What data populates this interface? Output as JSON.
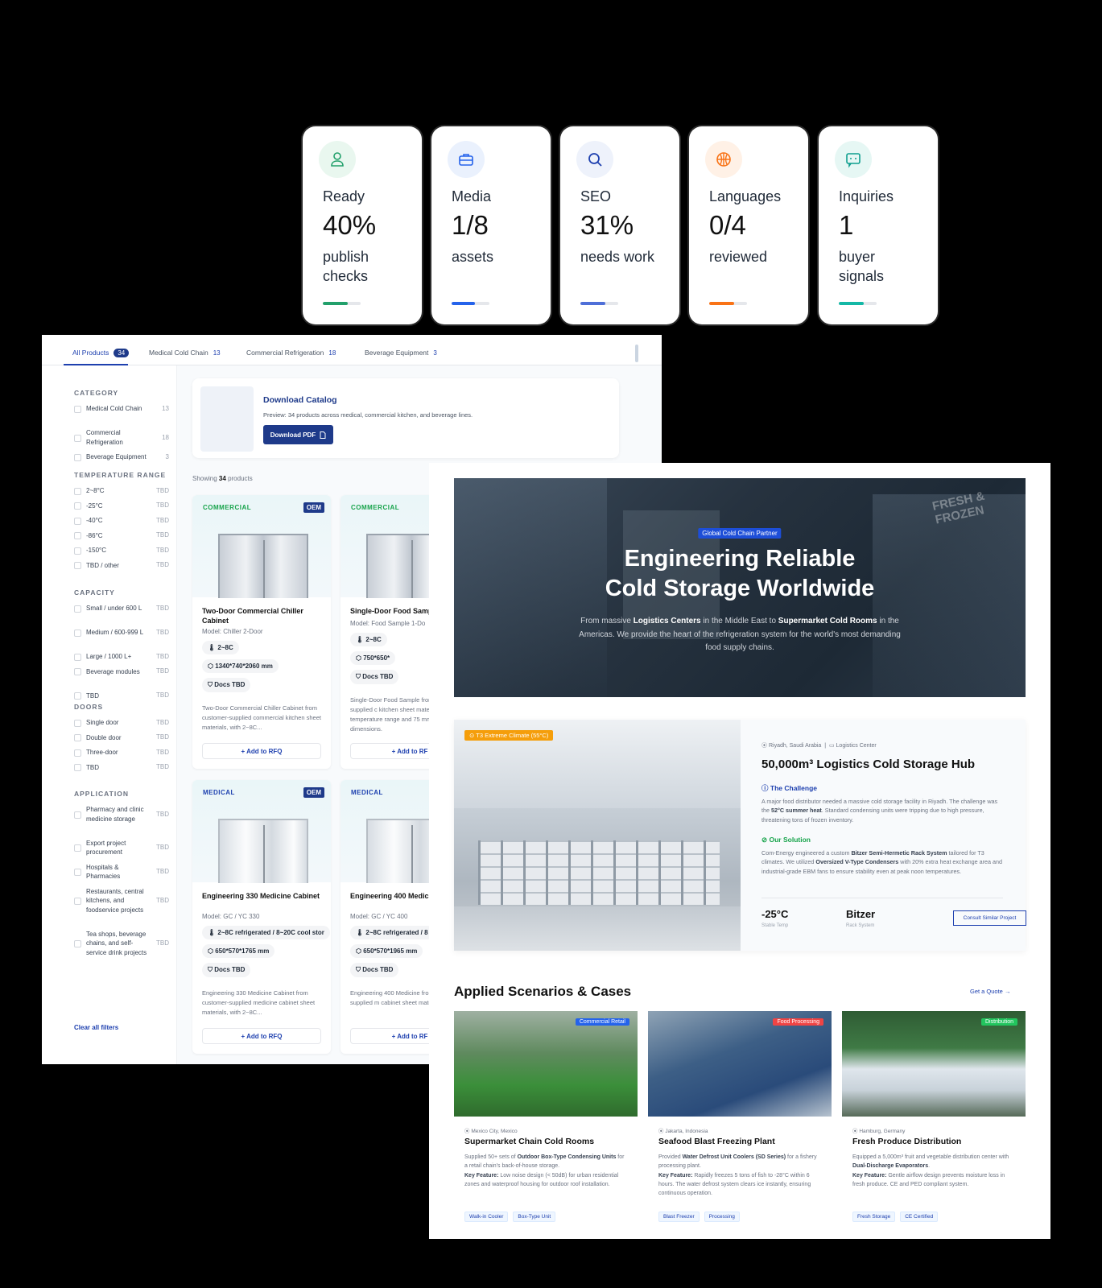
{
  "stats": [
    {
      "label": "Ready",
      "value": "40%",
      "sub": "publish checks",
      "icon": "user-icon",
      "icon_color": "#22a06b",
      "icon_bg": "#e9f7ef",
      "bar_color": "#22a06b",
      "progress": 0.65
    },
    {
      "label": "Media",
      "value": "1/8",
      "sub": "assets",
      "icon": "briefcase-icon",
      "icon_color": "#2563eb",
      "icon_bg": "#eaf1fd",
      "bar_color": "#2563eb",
      "progress": 0.62
    },
    {
      "label": "SEO",
      "value": "31%",
      "sub": "needs work",
      "icon": "search-icon",
      "icon_color": "#1e40af",
      "icon_bg": "#eef2fb",
      "bar_color": "#4f6fd8",
      "progress": 0.66
    },
    {
      "label": "Languages",
      "value": "0/4",
      "sub": "reviewed",
      "icon": "globe-icon",
      "icon_color": "#f97316",
      "icon_bg": "#fff1e6",
      "bar_color": "#f97316",
      "progress": 0.66
    },
    {
      "label": "Inquiries",
      "value": "1",
      "sub": "buyer signals",
      "icon": "chat-icon",
      "icon_color": "#0f9f8f",
      "icon_bg": "#e6f7f4",
      "bar_color": "#14b8a6",
      "progress": 0.66
    }
  ],
  "catalog": {
    "tabs": [
      {
        "label": "All Products",
        "count": "34"
      },
      {
        "label": "Medical Cold Chain",
        "count": "13"
      },
      {
        "label": "Commercial Refrigeration",
        "count": "18"
      },
      {
        "label": "Beverage Equipment",
        "count": "3"
      }
    ],
    "filters": {
      "category": {
        "title": "CATEGORY",
        "items": [
          {
            "label": "Medical Cold Chain",
            "count": "13"
          },
          {
            "label": "Commercial Refrigeration",
            "count": "18"
          },
          {
            "label": "Beverage Equipment",
            "count": "3"
          }
        ]
      },
      "temperature": {
        "title": "TEMPERATURE RANGE",
        "items": [
          {
            "label": "2~8°C",
            "count": "TBD"
          },
          {
            "label": "-25°C",
            "count": "TBD"
          },
          {
            "label": "-40°C",
            "count": "TBD"
          },
          {
            "label": "-86°C",
            "count": "TBD"
          },
          {
            "label": "-150°C",
            "count": "TBD"
          },
          {
            "label": "TBD / other",
            "count": "TBD"
          }
        ]
      },
      "capacity": {
        "title": "CAPACITY",
        "items": [
          {
            "label": "Small / under 600 L",
            "count": "TBD"
          },
          {
            "label": "Medium / 600-999 L",
            "count": "TBD"
          },
          {
            "label": "Large / 1000 L+",
            "count": "TBD"
          },
          {
            "label": "Beverage modules",
            "count": "TBD"
          },
          {
            "label": "TBD",
            "count": "TBD"
          }
        ]
      },
      "doors": {
        "title": "DOORS",
        "items": [
          {
            "label": "Single door",
            "count": "TBD"
          },
          {
            "label": "Double door",
            "count": "TBD"
          },
          {
            "label": "Three-door",
            "count": "TBD"
          },
          {
            "label": "TBD",
            "count": "TBD"
          }
        ]
      },
      "application": {
        "title": "APPLICATION",
        "items": [
          {
            "label": "Pharmacy and clinic medicine storage",
            "count": "TBD"
          },
          {
            "label": "Export project procurement",
            "count": "TBD"
          },
          {
            "label": "Hospitals & Pharmacies",
            "count": "TBD"
          },
          {
            "label": "Restaurants, central kitchens, and foodservice projects",
            "count": "TBD"
          },
          {
            "label": "Tea shops, beverage chains, and self-service drink projects",
            "count": "TBD"
          }
        ]
      },
      "clear_label": "Clear all filters"
    },
    "download": {
      "title": "Download Catalog",
      "preview": "Preview: 34 products across medical, commercial kitchen, and beverage lines.",
      "button": "Download PDF"
    },
    "showing_prefix": "Showing",
    "showing_count": "34",
    "showing_suffix": "products",
    "products": [
      {
        "tag": "COMMERCIAL",
        "tag_color": "#16a34a",
        "oem": "OEM",
        "name": "Two-Door Commercial Chiller Cabinet",
        "model": "Model: Chiller 2-Door",
        "temp": "2~8C",
        "dims": "1340*740*2060 mm",
        "docs": "Docs TBD",
        "desc": "Two-Door Commercial Chiller Cabinet from customer-supplied commercial kitchen sheet materials, with 2~8C...",
        "rfq": "+ Add to RFQ"
      },
      {
        "tag": "COMMERCIAL",
        "tag_color": "#16a34a",
        "oem": "",
        "name": "Single-Door Food Samp",
        "model": "Model: Food Sample 1-Do",
        "temp": "2~8C",
        "dims": "750*650*",
        "docs": "Docs TBD",
        "desc": "Single-Door Food Sample from customer-supplied c kitchen sheet materials, w temperature range and 75 mm cabinet dimensions.",
        "rfq": "+ Add to RF"
      },
      {
        "tag": "MEDICAL",
        "tag_color": "#1e40af",
        "oem": "OEM",
        "name": "Engineering 330 Medicine Cabinet",
        "model": "Model: GC / YC 330",
        "temp": "2~8C refrigerated / 8~20C cool stor",
        "dims": "650*570*1765 mm",
        "docs": "Docs TBD",
        "desc": "Engineering 330 Medicine Cabinet from customer-supplied medicine cabinet sheet materials, with 2~8C...",
        "rfq": "+ Add to RFQ"
      },
      {
        "tag": "MEDICAL",
        "tag_color": "#1e40af",
        "oem": "",
        "name": "Engineering 400 Medic Cabinet",
        "model": "Model: GC / YC 400",
        "temp": "2~8C refrigerated / 8",
        "dims": "650*570*1965 mm",
        "docs": "Docs TBD",
        "desc": "Engineering 400 Medicine from customer-supplied m cabinet sheet materials, w",
        "rfq": "+ Add to RF"
      }
    ]
  },
  "site": {
    "hero": {
      "badge": "Global Cold Chain Partner",
      "title_line1": "Engineering Reliable",
      "title_line2": "Cold Storage Worldwide",
      "sub_1": "From massive ",
      "sub_b1": "Logistics Centers",
      "sub_2": " in the Middle East to ",
      "sub_b2": "Supermarket Cold Rooms",
      "sub_3": " in the Americas. We provide the heart of the refrigeration system for the world's most demanding food supply chains.",
      "sign_text": "FRESH & FROZEN"
    },
    "case": {
      "tag": "T3 Extreme Climate (55°C)",
      "location": "Riyadh, Saudi Arabia",
      "type": "Logistics Center",
      "title": "50,000m³ Logistics Cold Storage Hub",
      "challenge_title": "The Challenge",
      "challenge_1": "A major food distributor needed a massive cold storage facility in Riyadh. The challenge was the ",
      "challenge_b": "52°C summer heat",
      "challenge_2": ". Standard condensing units were tripping due to high pressure, threatening tons of frozen inventory.",
      "solution_title": "Our Solution",
      "solution_1": "Com-Energy engineered a custom ",
      "solution_b1": "Bitzer Semi-Hermetic Rack System",
      "solution_2": " tailored for T3 climates. We utilized ",
      "solution_b2": "Oversized V-Type Condensers",
      "solution_3": " with 20% extra heat exchange area and industrial-grade EBM fans to ensure stability even at peak noon temperatures.",
      "stat1_value": "-25°C",
      "stat1_label": "Stable Temp",
      "stat2_value": "Bitzer",
      "stat2_label": "Rack System",
      "consult": "Consult Similar Project"
    },
    "scenarios_title": "Applied Scenarios & Cases",
    "quote_link": "Get a Quote →",
    "scenarios": [
      {
        "tag": "Commercial Retail",
        "tag_color": "#2563eb",
        "location": "Mexico City, Mexico",
        "name": "Supermarket Chain Cold Rooms",
        "d1": "Supplied 50+ sets of ",
        "b1": "Outdoor Box-Type Condensing Units",
        "d2": " for a retail chain's back-of-house storage.",
        "kf": "Key Feature:",
        "d3": " Low noise design (< 50dB) for urban residential zones and waterproof housing for outdoor roof installation.",
        "chips": [
          "Walk-in Cooler",
          "Box-Type Unit"
        ]
      },
      {
        "tag": "Food Processing",
        "tag_color": "#ef4444",
        "location": "Jakarta, Indonesia",
        "name": "Seafood Blast Freezing Plant",
        "d1": "Provided ",
        "b1": "Water Defrost Unit Coolers (SD Series)",
        "d2": " for a fishery processing plant.",
        "kf": "Key Feature:",
        "d3": " Rapidly freezes 5 tons of fish to -28°C within 6 hours. The water defrost system clears ice instantly, ensuring continuous operation.",
        "chips": [
          "Blast Freezer",
          "Processing"
        ]
      },
      {
        "tag": "Distribution",
        "tag_color": "#22c55e",
        "location": "Hamburg, Germany",
        "name": "Fresh Produce Distribution",
        "d1": "Equipped a 5,000m³ fruit and vegetable distribution center with ",
        "b1": "Dual-Discharge Evaporators",
        "d2": ".",
        "kf": "Key Feature:",
        "d3": " Gentle airflow design prevents moisture loss in fresh produce. CE and PED compliant system.",
        "chips": [
          "Fresh Storage",
          "CE Certified"
        ]
      }
    ]
  }
}
